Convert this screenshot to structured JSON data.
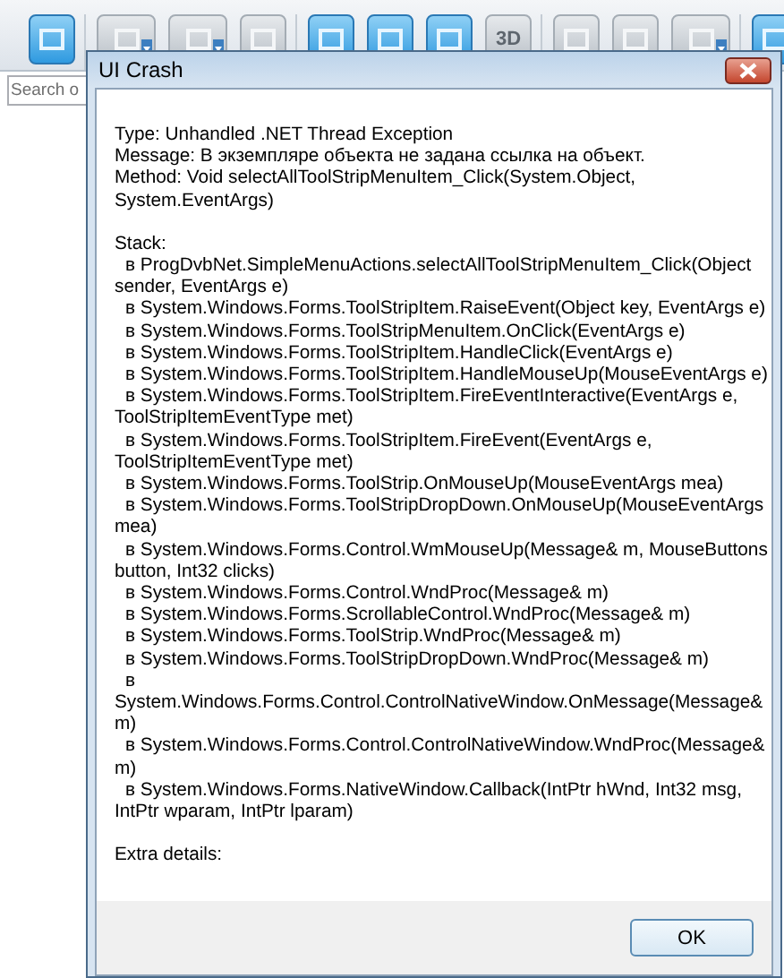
{
  "toolbar": {
    "groups": [
      [
        {
          "disabled": false,
          "dropdown": false
        }
      ],
      [
        {
          "disabled": true,
          "dropdown": true
        },
        {
          "disabled": true,
          "dropdown": true
        },
        {
          "disabled": true,
          "dropdown": false
        }
      ],
      [
        {
          "disabled": false,
          "dropdown": false
        },
        {
          "disabled": false,
          "dropdown": false
        },
        {
          "disabled": false,
          "dropdown": false
        },
        {
          "disabled": true,
          "dropdown": false,
          "label": "3D"
        }
      ],
      [
        {
          "disabled": true,
          "dropdown": false
        },
        {
          "disabled": true,
          "dropdown": false
        },
        {
          "disabled": true,
          "dropdown": true
        }
      ],
      [
        {
          "disabled": false,
          "dropdown": false
        }
      ]
    ]
  },
  "search": {
    "placeholder": "Search o"
  },
  "dialog": {
    "title": "UI Crash",
    "header_lines": [
      {
        "text": "Type: Unhandled .NET Thread Exception"
      },
      {
        "text": "Message: В экземпляре объекта не задана ссылка на объект."
      },
      {
        "text": "Method: Void selectAllToolStripMenuItem_Click(System.Object,"
      },
      {
        "text": "System.EventArgs)"
      }
    ],
    "stack_label": "Stack:",
    "stack_lines": [
      {
        "kind": "frame",
        "text": "в ProgDvbNet.SimpleMenuActions.selectAllToolStripMenuItem_Click(Object"
      },
      {
        "kind": "continuation",
        "text": "sender, EventArgs e)"
      },
      {
        "kind": "frame",
        "text": "в System.Windows.Forms.ToolStripItem.RaiseEvent(Object key, EventArgs e)"
      },
      {
        "kind": "frame",
        "text": "в System.Windows.Forms.ToolStripMenuItem.OnClick(EventArgs e)"
      },
      {
        "kind": "frame",
        "text": "в System.Windows.Forms.ToolStripItem.HandleClick(EventArgs e)"
      },
      {
        "kind": "frame",
        "text": "в System.Windows.Forms.ToolStripItem.HandleMouseUp(MouseEventArgs e)"
      },
      {
        "kind": "frame",
        "text": "в System.Windows.Forms.ToolStripItem.FireEventInteractive(EventArgs e,"
      },
      {
        "kind": "continuation",
        "text": "ToolStripItemEventType met)"
      },
      {
        "kind": "frame",
        "text": "в System.Windows.Forms.ToolStripItem.FireEvent(EventArgs e,"
      },
      {
        "kind": "continuation",
        "text": "ToolStripItemEventType met)"
      },
      {
        "kind": "frame",
        "text": "в System.Windows.Forms.ToolStrip.OnMouseUp(MouseEventArgs mea)"
      },
      {
        "kind": "frame",
        "text": "в System.Windows.Forms.ToolStripDropDown.OnMouseUp(MouseEventArgs"
      },
      {
        "kind": "continuation",
        "text": "mea)"
      },
      {
        "kind": "frame",
        "text": "в System.Windows.Forms.Control.WmMouseUp(Message& m, MouseButtons"
      },
      {
        "kind": "continuation",
        "text": "button, Int32 clicks)"
      },
      {
        "kind": "frame",
        "text": "в System.Windows.Forms.Control.WndProc(Message& m)"
      },
      {
        "kind": "frame",
        "text": "в System.Windows.Forms.ScrollableControl.WndProc(Message& m)"
      },
      {
        "kind": "frame",
        "text": "в System.Windows.Forms.ToolStrip.WndProc(Message& m)"
      },
      {
        "kind": "frame",
        "text": "в System.Windows.Forms.ToolStripDropDown.WndProc(Message& m)"
      },
      {
        "kind": "frame",
        "text": "в"
      },
      {
        "kind": "continuation",
        "text": "System.Windows.Forms.Control.ControlNativeWindow.OnMessage(Message&"
      },
      {
        "kind": "continuation",
        "text": "m)"
      },
      {
        "kind": "frame",
        "text": "в System.Windows.Forms.Control.ControlNativeWindow.WndProc(Message&"
      },
      {
        "kind": "continuation",
        "text": "m)"
      },
      {
        "kind": "frame",
        "text": "в System.Windows.Forms.NativeWindow.Callback(IntPtr hWnd, Int32 msg,"
      },
      {
        "kind": "continuation",
        "text": "IntPtr wparam, IntPtr lparam)"
      }
    ],
    "extra_label": "Extra details:",
    "buttons": [
      "OK"
    ]
  }
}
